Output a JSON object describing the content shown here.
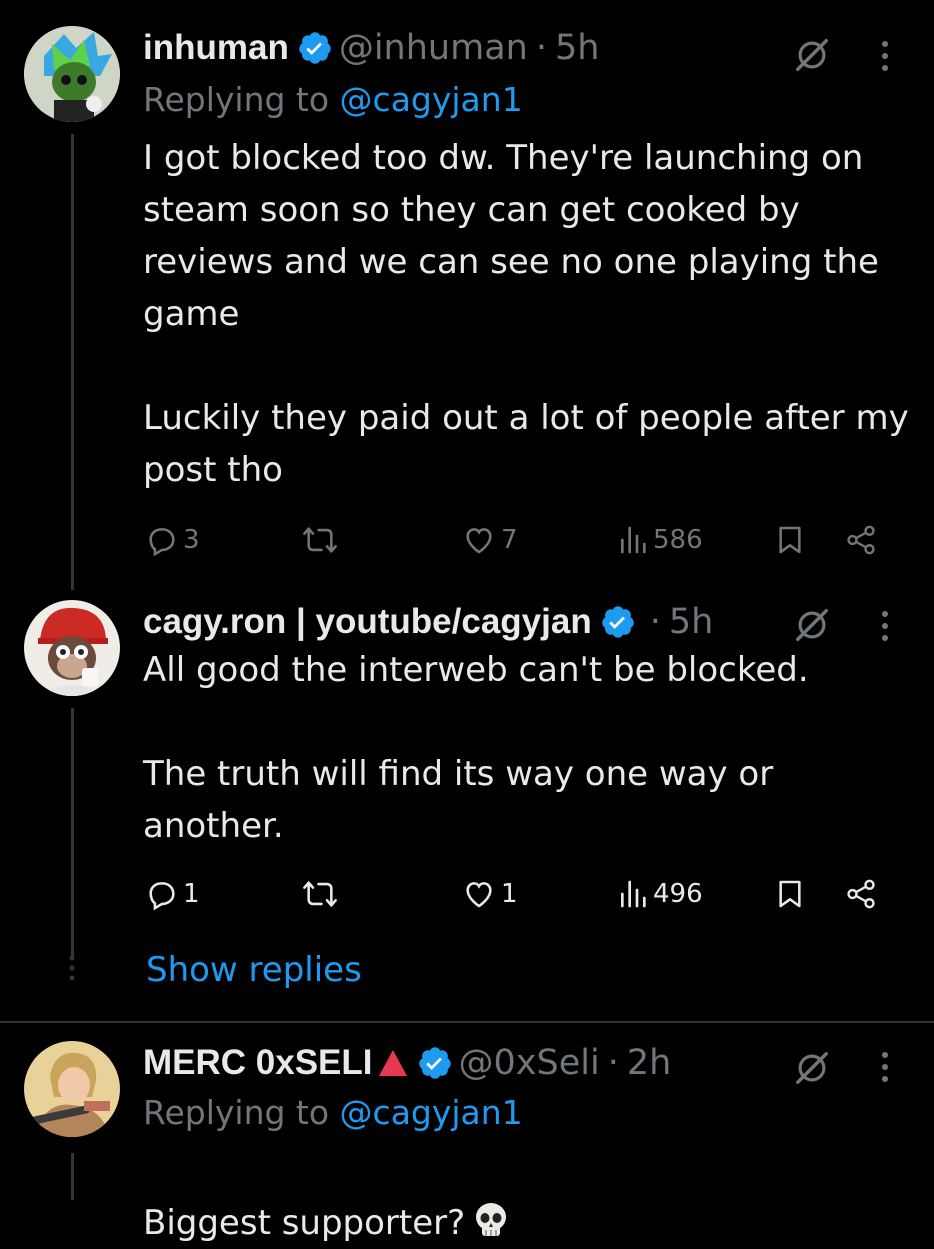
{
  "tweets": [
    {
      "name": "inhuman",
      "handle": "@inhuman",
      "time": "5h",
      "replying_prefix": "Replying to ",
      "replying_to": "@cagyjan1",
      "text": "I got blocked too dw. They're launching on steam soon so they can get cooked by reviews and we can see no one playing the game\n\nLuckily they paid out a lot of people after my post tho",
      "replies": "3",
      "reposts": "",
      "likes": "7",
      "views": "586"
    },
    {
      "name": "cagy.ron | youtube/cagyjan",
      "time": "5h",
      "text": "All good the interweb can't be blocked.\n\nThe truth will find its way one way or another.",
      "replies": "1",
      "reposts": "",
      "likes": "1",
      "views": "496",
      "show_replies": "Show replies"
    },
    {
      "name": "MERC 0xSELI",
      "handle": "@0xSeli",
      "time": "2h",
      "replying_prefix": "Replying to ",
      "replying_to": "@cagyjan1",
      "text": "Biggest supporter?"
    }
  ],
  "colors": {
    "background": "#000000",
    "text": "#e7e9ea",
    "muted": "#71767b",
    "link": "#1d9bf0",
    "verified": "#1d9bf0"
  },
  "icons": [
    "verified-badge-icon",
    "grok-icon",
    "more-icon",
    "reply-icon",
    "repost-icon",
    "like-icon",
    "views-icon",
    "bookmark-icon",
    "share-icon",
    "skull-emoji",
    "red-triangle-emoji"
  ]
}
